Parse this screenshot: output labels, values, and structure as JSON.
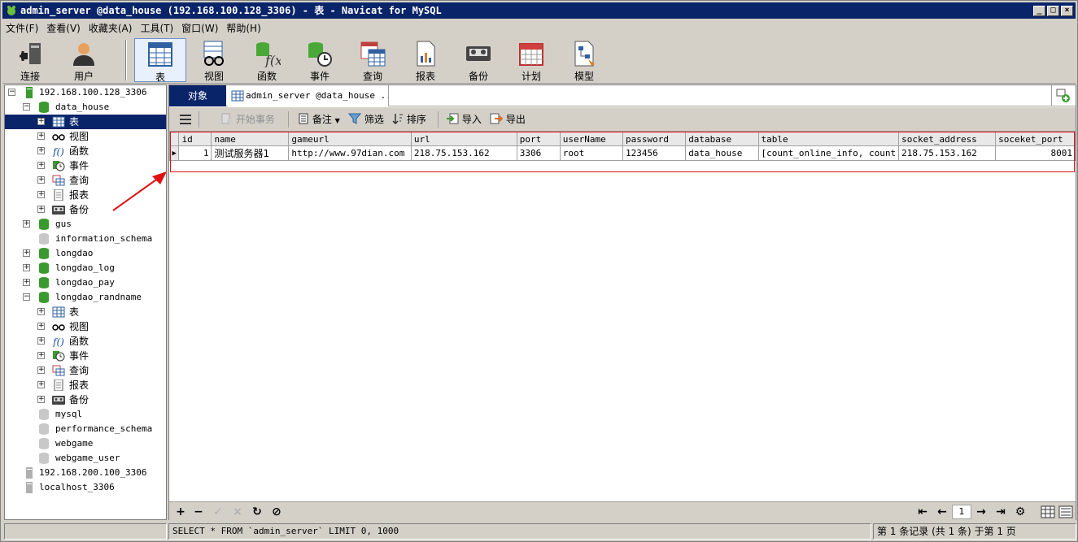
{
  "window": {
    "title": "admin_server @data_house (192.168.100.128_3306) - 表 - Navicat for MySQL",
    "minimize": "_",
    "maximize": "□",
    "close": "×"
  },
  "menu": [
    "文件(F)",
    "查看(V)",
    "收藏夹(A)",
    "工具(T)",
    "窗口(W)",
    "帮助(H)"
  ],
  "toolbar": {
    "connect": "连接",
    "user": "用户",
    "table": "表",
    "view": "视图",
    "function": "函数",
    "event": "事件",
    "query": "查询",
    "report": "报表",
    "backup": "备份",
    "schedule": "计划",
    "model": "模型"
  },
  "tree": {
    "conn1": "192.168.100.128_3306",
    "db_data_house": "data_house",
    "n_table": "表",
    "n_view": "视图",
    "n_function": "函数",
    "n_event": "事件",
    "n_query": "查询",
    "n_report": "报表",
    "n_backup": "备份",
    "db_gus": "gus",
    "db_information_schema": "information_schema",
    "db_longdao": "longdao",
    "db_longdao_log": "longdao_log",
    "db_longdao_pay": "longdao_pay",
    "db_longdao_randname": "longdao_randname",
    "r_table": "表",
    "r_view": "视图",
    "r_function": "函数",
    "r_event": "事件",
    "r_query": "查询",
    "r_report": "报表",
    "r_backup": "备份",
    "db_mysql": "mysql",
    "db_performance_schema": "performance_schema",
    "db_webgame": "webgame",
    "db_webgame_user": "webgame_user",
    "conn2": "192.168.200.100_3306",
    "conn3": "localhost_3306"
  },
  "tabs": {
    "objects": "对象",
    "doc": "admin_server @data_house ..."
  },
  "subtoolbar": {
    "begin_tx": "开始事务",
    "memo": "备注",
    "filter": "筛选",
    "sort": "排序",
    "import": "导入",
    "export": "导出"
  },
  "grid": {
    "columns": [
      "id",
      "name",
      "gameurl",
      "url",
      "port",
      "userName",
      "password",
      "database",
      "table",
      "socket_address",
      "soceket_port"
    ],
    "rows": [
      [
        "1",
        "测试服务器1",
        "http://www.97dian.com",
        "218.75.153.162",
        "3306",
        "root",
        "123456",
        "data_house",
        "[count_online_info, count",
        "218.75.153.162",
        "8001"
      ]
    ]
  },
  "pager": {
    "page": "1"
  },
  "status": {
    "sql": "SELECT * FROM `admin_server` LIMIT 0, 1000",
    "records": "第 1 条记录 (共 1 条) 于第 1 页"
  }
}
